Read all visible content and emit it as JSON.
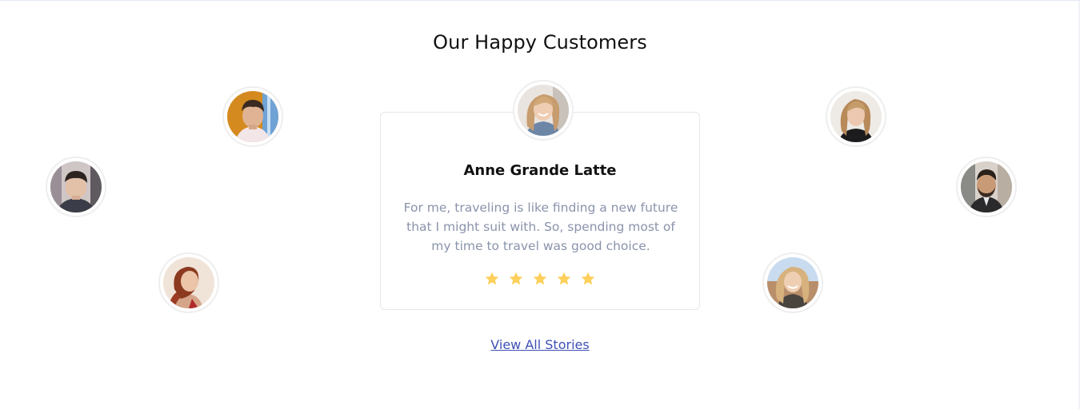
{
  "section": {
    "title": "Our Happy Customers"
  },
  "featured": {
    "name": "Anne Grande Latte",
    "quote": "For me, traveling is like finding a new future that I might suit with. So, spending most of my time to travel was good choice.",
    "rating": 5,
    "max_rating": 5
  },
  "footer": {
    "view_all_label": "View All Stories"
  },
  "colors": {
    "star": "#ffd05b",
    "link": "#3f51b5",
    "quote_text": "#8a93ab",
    "card_border": "#e4e7ec"
  },
  "avatars": [
    {
      "icon": "customer-avatar-man-orange-background"
    },
    {
      "icon": "customer-avatar-man-dark-hair"
    },
    {
      "icon": "customer-avatar-woman-red-hair"
    },
    {
      "icon": "customer-avatar-woman-wavy-blonde"
    },
    {
      "icon": "customer-avatar-man-beard"
    },
    {
      "icon": "customer-avatar-woman-blonde-smiling"
    },
    {
      "icon": "featured-customer-avatar"
    }
  ]
}
